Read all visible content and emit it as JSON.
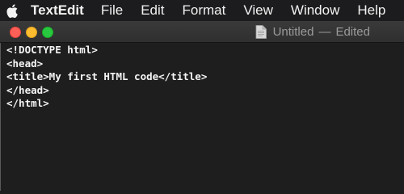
{
  "menubar": {
    "apple_icon": "apple-logo-icon",
    "app_name": "TextEdit",
    "items": [
      "File",
      "Edit",
      "Format",
      "View",
      "Window",
      "Help"
    ]
  },
  "window": {
    "title": "Untitled",
    "separator": "—",
    "status": "Edited",
    "document_icon": "document-icon",
    "traffic_lights": {
      "close_color": "#fe5f57",
      "minimize_color": "#febc2e",
      "zoom_color": "#28c840"
    }
  },
  "editor": {
    "lines": [
      "<!DOCTYPE html>",
      "<head>",
      "<title>My first HTML code</title>",
      "</head>",
      "</html>"
    ]
  }
}
